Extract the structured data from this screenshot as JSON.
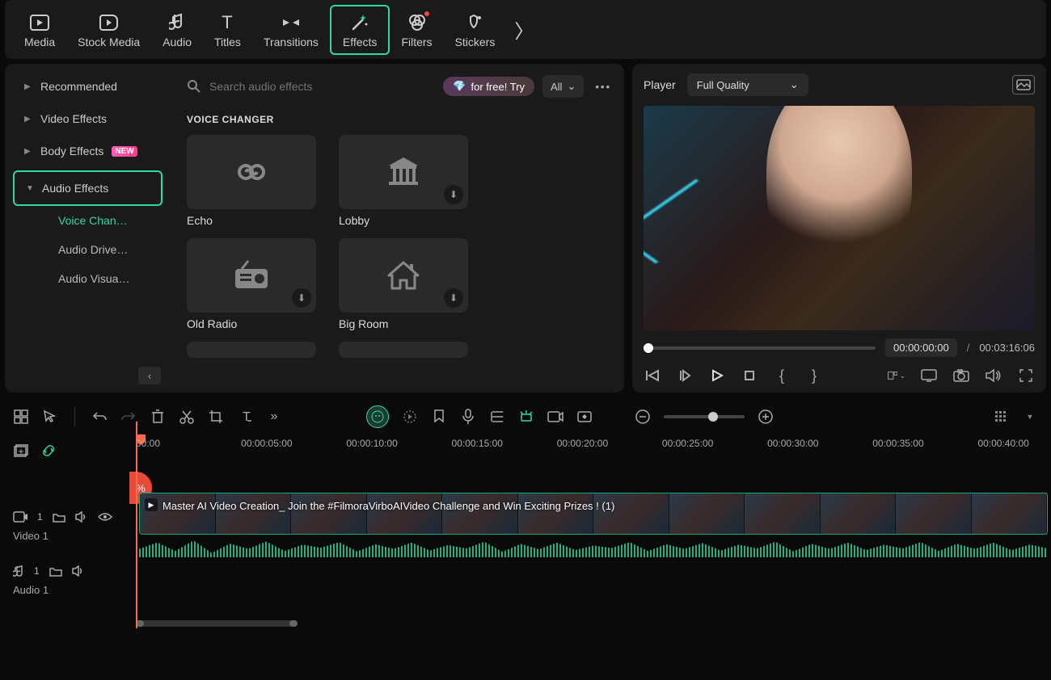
{
  "nav": {
    "items": [
      {
        "label": "Media"
      },
      {
        "label": "Stock Media"
      },
      {
        "label": "Audio"
      },
      {
        "label": "Titles"
      },
      {
        "label": "Transitions"
      },
      {
        "label": "Effects"
      },
      {
        "label": "Filters"
      },
      {
        "label": "Stickers"
      }
    ]
  },
  "sidebar": {
    "items": [
      {
        "label": "Recommended"
      },
      {
        "label": "Video Effects"
      },
      {
        "label": "Body Effects",
        "badge": "NEW"
      },
      {
        "label": "Audio Effects"
      }
    ],
    "subs": [
      {
        "label": "Voice Chan…"
      },
      {
        "label": "Audio Drive…"
      },
      {
        "label": "Audio Visua…"
      }
    ]
  },
  "search": {
    "placeholder": "Search audio effects",
    "freeTry": "for free! Try",
    "all": "All"
  },
  "effects": {
    "sectionTitle": "VOICE CHANGER",
    "cards": [
      {
        "label": "Echo"
      },
      {
        "label": "Lobby"
      },
      {
        "label": "Old Radio"
      },
      {
        "label": "Big Room"
      }
    ]
  },
  "player": {
    "label": "Player",
    "quality": "Full Quality",
    "currentTime": "00:00:00:00",
    "duration": "00:03:16:06"
  },
  "ruler": {
    "marks": [
      "00:00",
      "00:00:05:00",
      "00:00:10:00",
      "00:00:15:00",
      "00:00:20:00",
      "00:00:25:00",
      "00:00:30:00",
      "00:00:35:00",
      "00:00:40:00"
    ]
  },
  "tracks": {
    "video": {
      "name": "Video 1",
      "index": "1"
    },
    "audio": {
      "name": "Audio 1",
      "index": "1"
    },
    "clipTitle": "Master AI Video Creation_ Join the #FilmoraVirboAIVideo Challenge and Win Exciting Prizes ! (1)",
    "promoPercent": "%"
  }
}
